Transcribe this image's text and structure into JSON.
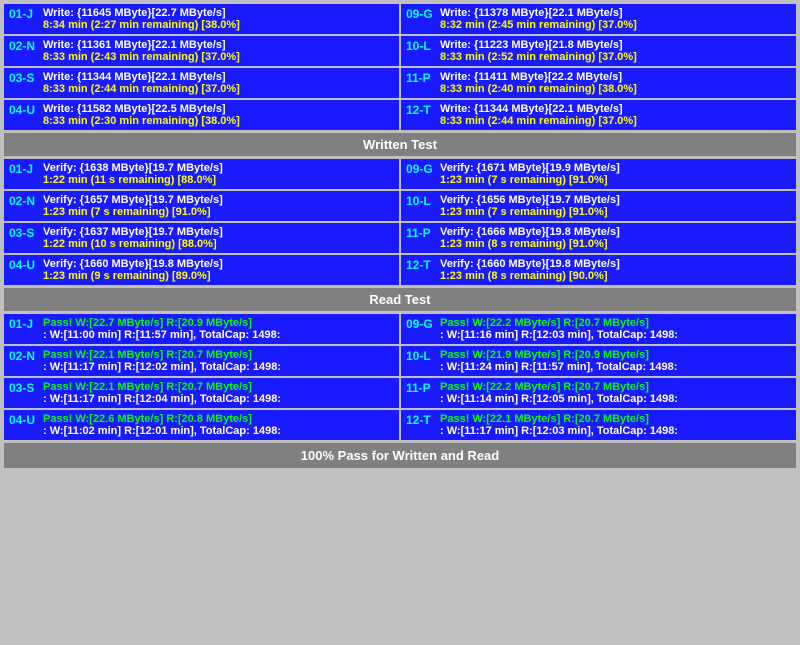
{
  "sections": {
    "write_test": {
      "header": "Written Test",
      "rows": [
        {
          "left": {
            "id": "01-J",
            "line1": "Write: {11645 MByte}[22.7 MByte/s]",
            "line2": "8:34 min (2:27 min remaining)  [38.0%]"
          },
          "right": {
            "id": "09-G",
            "line1": "Write: {11378 MByte}[22.1 MByte/s]",
            "line2": "8:32 min (2:45 min remaining)  [37.0%]"
          }
        },
        {
          "left": {
            "id": "02-N",
            "line1": "Write: {11361 MByte}[22.1 MByte/s]",
            "line2": "8:33 min (2:43 min remaining)  [37.0%]"
          },
          "right": {
            "id": "10-L",
            "line1": "Write: {11223 MByte}[21.8 MByte/s]",
            "line2": "8:33 min (2:52 min remaining)  [37.0%]"
          }
        },
        {
          "left": {
            "id": "03-S",
            "line1": "Write: {11344 MByte}[22.1 MByte/s]",
            "line2": "8:33 min (2:44 min remaining)  [37.0%]"
          },
          "right": {
            "id": "11-P",
            "line1": "Write: {11411 MByte}[22.2 MByte/s]",
            "line2": "8:33 min (2:40 min remaining)  [38.0%]"
          }
        },
        {
          "left": {
            "id": "04-U",
            "line1": "Write: {11582 MByte}[22.5 MByte/s]",
            "line2": "8:33 min (2:30 min remaining)  [38.0%]"
          },
          "right": {
            "id": "12-T",
            "line1": "Write: {11344 MByte}[22.1 MByte/s]",
            "line2": "8:33 min (2:44 min remaining)  [37.0%]"
          }
        }
      ]
    },
    "verify_test": {
      "header": "Written Test",
      "rows": [
        {
          "left": {
            "id": "01-J",
            "line1": "Verify: {1638 MByte}[19.7 MByte/s]",
            "line2": "1:22 min (11 s remaining)   [88.0%]"
          },
          "right": {
            "id": "09-G",
            "line1": "Verify: {1671 MByte}[19.9 MByte/s]",
            "line2": "1:23 min (7 s remaining)   [91.0%]"
          }
        },
        {
          "left": {
            "id": "02-N",
            "line1": "Verify: {1657 MByte}[19.7 MByte/s]",
            "line2": "1:23 min (7 s remaining)   [91.0%]"
          },
          "right": {
            "id": "10-L",
            "line1": "Verify: {1656 MByte}[19.7 MByte/s]",
            "line2": "1:23 min (7 s remaining)   [91.0%]"
          }
        },
        {
          "left": {
            "id": "03-S",
            "line1": "Verify: {1637 MByte}[19.7 MByte/s]",
            "line2": "1:22 min (10 s remaining)   [88.0%]"
          },
          "right": {
            "id": "11-P",
            "line1": "Verify: {1666 MByte}[19.8 MByte/s]",
            "line2": "1:23 min (8 s remaining)   [91.0%]"
          }
        },
        {
          "left": {
            "id": "04-U",
            "line1": "Verify: {1660 MByte}[19.8 MByte/s]",
            "line2": "1:23 min (9 s remaining)   [89.0%]"
          },
          "right": {
            "id": "12-T",
            "line1": "Verify: {1660 MByte}[19.8 MByte/s]",
            "line2": "1:23 min (8 s remaining)   [90.0%]"
          }
        }
      ]
    },
    "read_test": {
      "header": "Read Test",
      "rows": [
        {
          "left": {
            "id": "01-J",
            "line1": "Pass! W:[22.7 MByte/s] R:[20.9 MByte/s]",
            "line2": ": W:[11:00 min] R:[11:57 min], TotalCap: 1498:"
          },
          "right": {
            "id": "09-G",
            "line1": "Pass! W:[22.2 MByte/s] R:[20.7 MByte/s]",
            "line2": ": W:[11:16 min] R:[12:03 min], TotalCap: 1498:"
          }
        },
        {
          "left": {
            "id": "02-N",
            "line1": "Pass! W:[22.1 MByte/s] R:[20.7 MByte/s]",
            "line2": ": W:[11:17 min] R:[12:02 min], TotalCap: 1498:"
          },
          "right": {
            "id": "10-L",
            "line1": "Pass! W:[21.9 MByte/s] R:[20.9 MByte/s]",
            "line2": ": W:[11:24 min] R:[11:57 min], TotalCap: 1498:"
          }
        },
        {
          "left": {
            "id": "03-S",
            "line1": "Pass! W:[22.1 MByte/s] R:[20.7 MByte/s]",
            "line2": ": W:[11:17 min] R:[12:04 min], TotalCap: 1498:"
          },
          "right": {
            "id": "11-P",
            "line1": "Pass! W:[22.2 MByte/s] R:[20.7 MByte/s]",
            "line2": ": W:[11:14 min] R:[12:05 min], TotalCap: 1498:"
          }
        },
        {
          "left": {
            "id": "04-U",
            "line1": "Pass! W:[22.6 MByte/s] R:[20.8 MByte/s]",
            "line2": ": W:[11:02 min] R:[12:01 min], TotalCap: 1498:"
          },
          "right": {
            "id": "12-T",
            "line1": "Pass! W:[22.1 MByte/s] R:[20.7 MByte/s]",
            "line2": ": W:[11:17 min] R:[12:03 min], TotalCap: 1498:"
          }
        }
      ]
    }
  },
  "footer": "100% Pass for Written and Read"
}
